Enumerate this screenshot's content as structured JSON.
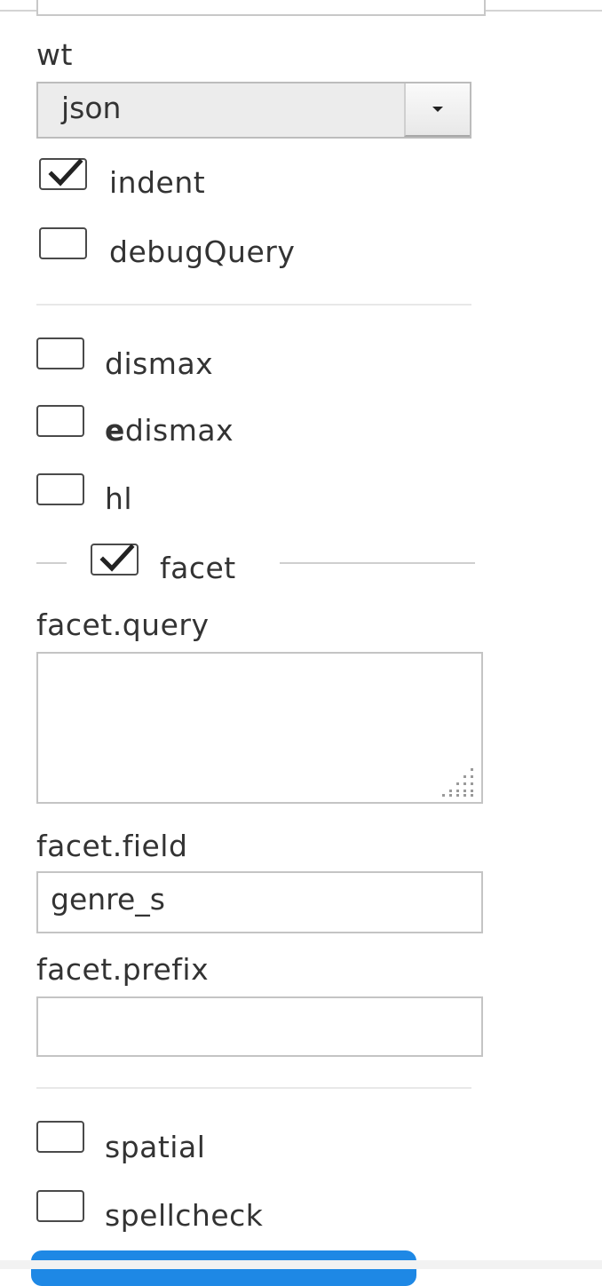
{
  "form": {
    "wt": {
      "label": "wt",
      "selected": "json"
    },
    "indent": {
      "label": "indent",
      "checked": true
    },
    "debugQuery": {
      "label": "debugQuery",
      "checked": false
    },
    "dismax": {
      "label": "dismax",
      "checked": false
    },
    "edismax": {
      "label_prefix": "e",
      "label_rest": "dismax",
      "checked": false
    },
    "hl": {
      "label": "hl",
      "checked": false
    },
    "facet": {
      "label": "facet",
      "checked": true,
      "query": {
        "label": "facet.query",
        "value": ""
      },
      "field": {
        "label": "facet.field",
        "value": "genre_s"
      },
      "prefix": {
        "label": "facet.prefix",
        "value": ""
      }
    },
    "spatial": {
      "label": "spatial",
      "checked": false
    },
    "spellcheck": {
      "label": "spellcheck",
      "checked": false
    }
  },
  "icons": {
    "checkmark": "check-icon",
    "dropdown": "chevron-down-icon",
    "resize": "resize-grip-icon"
  },
  "colors": {
    "accent": "#1e88e5",
    "border": "#c4c4c4",
    "select_bg": "#ececec",
    "text": "#333333"
  }
}
